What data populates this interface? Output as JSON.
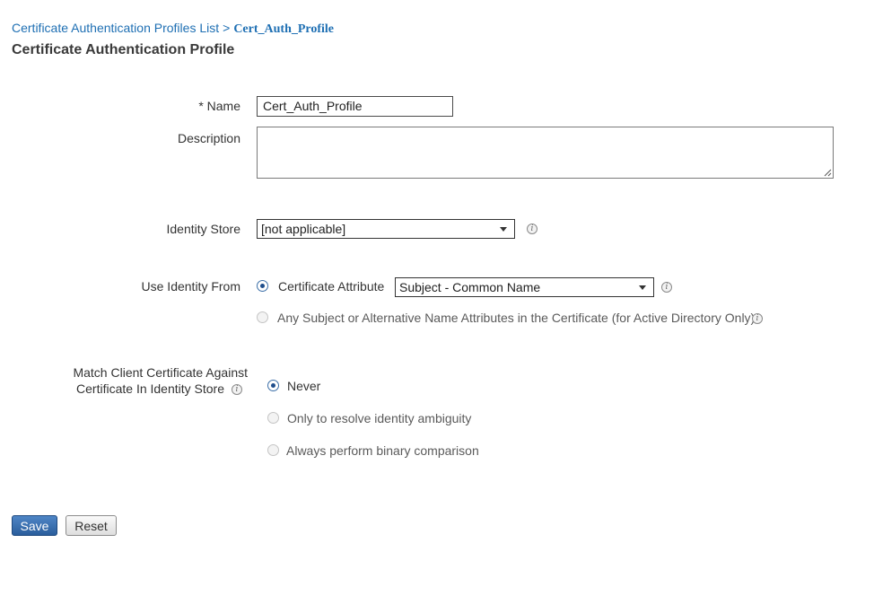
{
  "breadcrumb": {
    "parent": "Certificate Authentication Profiles List",
    "separator": ">",
    "current": "Cert_Auth_Profile"
  },
  "page_title": "Certificate Authentication Profile",
  "form": {
    "name_label": "* Name",
    "name_value": "Cert_Auth_Profile",
    "description_label": "Description",
    "description_value": "",
    "identity_store_label": "Identity Store",
    "identity_store_value": "[not applicable]",
    "use_identity_from_label": "Use Identity From",
    "identity_option_certificate_attribute": "Certificate Attribute",
    "certificate_attribute_value": "Subject - Common Name",
    "identity_option_any_subject": "Any Subject or Alternative Name Attributes in the Certificate (for Active Directory Only)",
    "match_label_line1": "Match Client Certificate Against",
    "match_label_line2": "Certificate In Identity Store",
    "match_option_never": "Never",
    "match_option_resolve": "Only to resolve identity ambiguity",
    "match_option_always": "Always perform binary comparison"
  },
  "buttons": {
    "save": "Save",
    "reset": "Reset"
  },
  "icons": {
    "info": "info-icon",
    "dropdown": "chevron-down-icon"
  },
  "colors": {
    "link": "#1e6fb3",
    "primary_button": "#2a5d9c"
  }
}
